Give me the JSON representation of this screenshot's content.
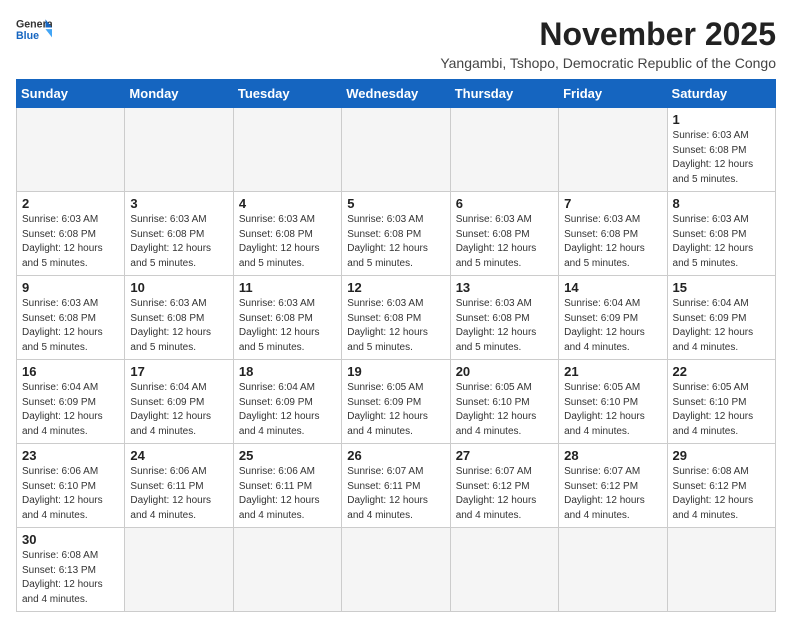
{
  "header": {
    "logo_general": "General",
    "logo_blue": "Blue",
    "month_title": "November 2025",
    "subtitle": "Yangambi, Tshopo, Democratic Republic of the Congo"
  },
  "days_of_week": [
    "Sunday",
    "Monday",
    "Tuesday",
    "Wednesday",
    "Thursday",
    "Friday",
    "Saturday"
  ],
  "weeks": [
    [
      {
        "day": "",
        "empty": true
      },
      {
        "day": "",
        "empty": true
      },
      {
        "day": "",
        "empty": true
      },
      {
        "day": "",
        "empty": true
      },
      {
        "day": "",
        "empty": true
      },
      {
        "day": "",
        "empty": true
      },
      {
        "day": "1",
        "sunrise": "6:03 AM",
        "sunset": "6:08 PM",
        "daylight": "12 hours and 5 minutes."
      }
    ],
    [
      {
        "day": "2",
        "sunrise": "6:03 AM",
        "sunset": "6:08 PM",
        "daylight": "12 hours and 5 minutes."
      },
      {
        "day": "3",
        "sunrise": "6:03 AM",
        "sunset": "6:08 PM",
        "daylight": "12 hours and 5 minutes."
      },
      {
        "day": "4",
        "sunrise": "6:03 AM",
        "sunset": "6:08 PM",
        "daylight": "12 hours and 5 minutes."
      },
      {
        "day": "5",
        "sunrise": "6:03 AM",
        "sunset": "6:08 PM",
        "daylight": "12 hours and 5 minutes."
      },
      {
        "day": "6",
        "sunrise": "6:03 AM",
        "sunset": "6:08 PM",
        "daylight": "12 hours and 5 minutes."
      },
      {
        "day": "7",
        "sunrise": "6:03 AM",
        "sunset": "6:08 PM",
        "daylight": "12 hours and 5 minutes."
      },
      {
        "day": "8",
        "sunrise": "6:03 AM",
        "sunset": "6:08 PM",
        "daylight": "12 hours and 5 minutes."
      }
    ],
    [
      {
        "day": "9",
        "sunrise": "6:03 AM",
        "sunset": "6:08 PM",
        "daylight": "12 hours and 5 minutes."
      },
      {
        "day": "10",
        "sunrise": "6:03 AM",
        "sunset": "6:08 PM",
        "daylight": "12 hours and 5 minutes."
      },
      {
        "day": "11",
        "sunrise": "6:03 AM",
        "sunset": "6:08 PM",
        "daylight": "12 hours and 5 minutes."
      },
      {
        "day": "12",
        "sunrise": "6:03 AM",
        "sunset": "6:08 PM",
        "daylight": "12 hours and 5 minutes."
      },
      {
        "day": "13",
        "sunrise": "6:03 AM",
        "sunset": "6:08 PM",
        "daylight": "12 hours and 5 minutes."
      },
      {
        "day": "14",
        "sunrise": "6:04 AM",
        "sunset": "6:09 PM",
        "daylight": "12 hours and 4 minutes."
      },
      {
        "day": "15",
        "sunrise": "6:04 AM",
        "sunset": "6:09 PM",
        "daylight": "12 hours and 4 minutes."
      }
    ],
    [
      {
        "day": "16",
        "sunrise": "6:04 AM",
        "sunset": "6:09 PM",
        "daylight": "12 hours and 4 minutes."
      },
      {
        "day": "17",
        "sunrise": "6:04 AM",
        "sunset": "6:09 PM",
        "daylight": "12 hours and 4 minutes."
      },
      {
        "day": "18",
        "sunrise": "6:04 AM",
        "sunset": "6:09 PM",
        "daylight": "12 hours and 4 minutes."
      },
      {
        "day": "19",
        "sunrise": "6:05 AM",
        "sunset": "6:09 PM",
        "daylight": "12 hours and 4 minutes."
      },
      {
        "day": "20",
        "sunrise": "6:05 AM",
        "sunset": "6:10 PM",
        "daylight": "12 hours and 4 minutes."
      },
      {
        "day": "21",
        "sunrise": "6:05 AM",
        "sunset": "6:10 PM",
        "daylight": "12 hours and 4 minutes."
      },
      {
        "day": "22",
        "sunrise": "6:05 AM",
        "sunset": "6:10 PM",
        "daylight": "12 hours and 4 minutes."
      }
    ],
    [
      {
        "day": "23",
        "sunrise": "6:06 AM",
        "sunset": "6:10 PM",
        "daylight": "12 hours and 4 minutes."
      },
      {
        "day": "24",
        "sunrise": "6:06 AM",
        "sunset": "6:11 PM",
        "daylight": "12 hours and 4 minutes."
      },
      {
        "day": "25",
        "sunrise": "6:06 AM",
        "sunset": "6:11 PM",
        "daylight": "12 hours and 4 minutes."
      },
      {
        "day": "26",
        "sunrise": "6:07 AM",
        "sunset": "6:11 PM",
        "daylight": "12 hours and 4 minutes."
      },
      {
        "day": "27",
        "sunrise": "6:07 AM",
        "sunset": "6:12 PM",
        "daylight": "12 hours and 4 minutes."
      },
      {
        "day": "28",
        "sunrise": "6:07 AM",
        "sunset": "6:12 PM",
        "daylight": "12 hours and 4 minutes."
      },
      {
        "day": "29",
        "sunrise": "6:08 AM",
        "sunset": "6:12 PM",
        "daylight": "12 hours and 4 minutes."
      }
    ],
    [
      {
        "day": "30",
        "sunrise": "6:08 AM",
        "sunset": "6:13 PM",
        "daylight": "12 hours and 4 minutes."
      },
      {
        "day": "",
        "empty": true
      },
      {
        "day": "",
        "empty": true
      },
      {
        "day": "",
        "empty": true
      },
      {
        "day": "",
        "empty": true
      },
      {
        "day": "",
        "empty": true
      },
      {
        "day": "",
        "empty": true
      }
    ]
  ]
}
